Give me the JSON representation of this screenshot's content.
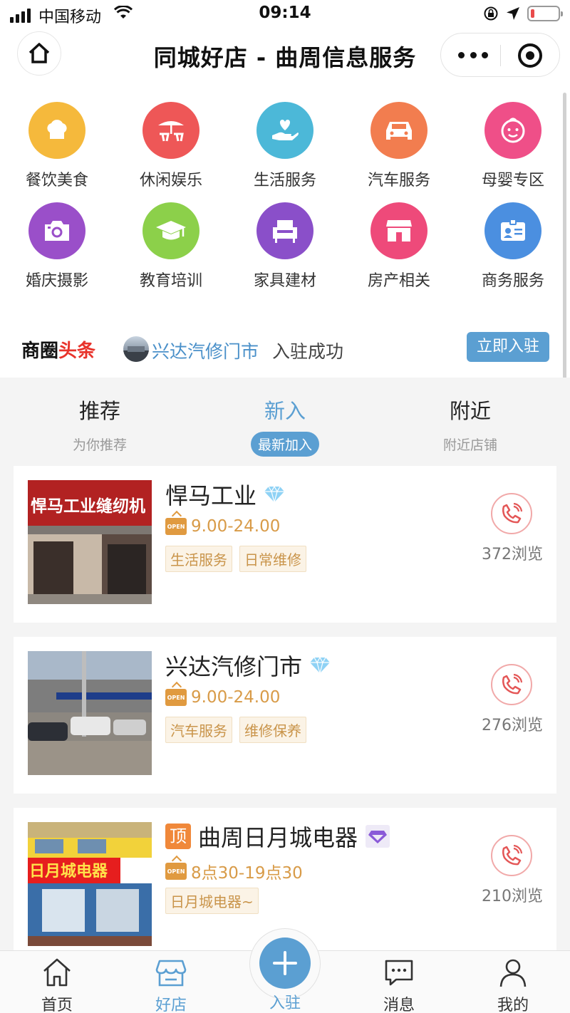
{
  "status_bar": {
    "carrier": "中国移动",
    "time": "09:14",
    "battery_level": 0.12
  },
  "nav": {
    "title": "同城好店 - 曲周信息服务"
  },
  "categories": [
    {
      "label": "餐饮美食",
      "icon": "chef-hat-icon",
      "color": "#f5b93c"
    },
    {
      "label": "休闲娱乐",
      "icon": "beach-umbrella-icon",
      "color": "#ee5757"
    },
    {
      "label": "生活服务",
      "icon": "heart-hand-icon",
      "color": "#4cb8d8"
    },
    {
      "label": "汽车服务",
      "icon": "car-icon",
      "color": "#f27d4f"
    },
    {
      "label": "母婴专区",
      "icon": "baby-face-icon",
      "color": "#ef4f88"
    },
    {
      "label": "婚庆摄影",
      "icon": "camera-icon",
      "color": "#9a4fc9"
    },
    {
      "label": "教育培训",
      "icon": "graduation-cap-icon",
      "color": "#8cd04a"
    },
    {
      "label": "家具建材",
      "icon": "armchair-icon",
      "color": "#8a4fc9"
    },
    {
      "label": "房产相关",
      "icon": "storefront-icon",
      "color": "#ee4a7a"
    },
    {
      "label": "商务服务",
      "icon": "id-card-icon",
      "color": "#4b8fe0"
    }
  ],
  "headline": {
    "title_part1": "商圈",
    "title_part2": "头条",
    "shop": "兴达汽修门市",
    "status": "入驻成功",
    "join_label": "立即入驻"
  },
  "tabs": [
    {
      "label": "推荐",
      "sub": "为你推荐"
    },
    {
      "label": "新入",
      "sub": "最新加入"
    },
    {
      "label": "附近",
      "sub": "附近店铺"
    }
  ],
  "shops": [
    {
      "name": "悍马工业",
      "hours": "9.00-24.00",
      "tags": [
        "生活服务",
        "日常维修"
      ],
      "views": "372浏览",
      "badge": "diamond-icon",
      "top": "",
      "photo_sign": "悍马工业缝纫机"
    },
    {
      "name": "兴达汽修门市",
      "hours": "9.00-24.00",
      "tags": [
        "汽车服务",
        "维修保养"
      ],
      "views": "276浏览",
      "badge": "diamond-icon",
      "top": ""
    },
    {
      "name": "曲周日月城电器",
      "hours": "8点30-19点30",
      "tags": [
        "日月城电器~"
      ],
      "views": "210浏览",
      "badge": "purple-diamond-icon",
      "top": "顶",
      "photo_sign": "日月城电器"
    }
  ],
  "open_badge_text": "OPEN",
  "tab_bar": {
    "home": "首页",
    "shops": "好店",
    "join": "入驻",
    "messages": "消息",
    "mine": "我的"
  }
}
